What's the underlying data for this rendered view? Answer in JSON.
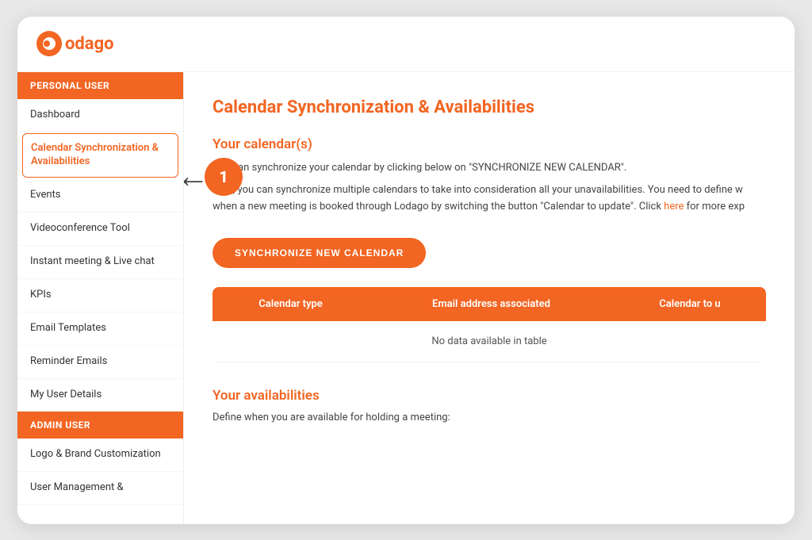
{
  "app": {
    "logo_text": "odago",
    "logo_icon": "O"
  },
  "sidebar": {
    "personal_user_label": "PERSONAL USER",
    "admin_user_label": "ADMIN USER",
    "items_personal": [
      {
        "id": "dashboard",
        "label": "Dashboard",
        "active": false
      },
      {
        "id": "calendar-sync",
        "label": "Calendar Synchronization & Availabilities",
        "active": true
      },
      {
        "id": "events",
        "label": "Events",
        "active": false
      },
      {
        "id": "videoconference",
        "label": "Videoconference Tool",
        "active": false
      },
      {
        "id": "instant-meeting",
        "label": "Instant meeting & Live chat",
        "active": false
      },
      {
        "id": "kpis",
        "label": "KPIs",
        "active": false
      },
      {
        "id": "email-templates",
        "label": "Email Templates",
        "active": false
      },
      {
        "id": "reminder-emails",
        "label": "Reminder Emails",
        "active": false
      },
      {
        "id": "my-user-details",
        "label": "My User Details",
        "active": false
      }
    ],
    "items_admin": [
      {
        "id": "logo-brand",
        "label": "Logo & Brand Customization",
        "active": false
      },
      {
        "id": "user-management",
        "label": "User Management &",
        "active": false
      }
    ]
  },
  "content": {
    "page_title": "Calendar Synchronization & Availabilities",
    "your_calendars_title": "Your calendar(s)",
    "description_1": "You can synchronize your calendar by clicking below on \"SYNCHRONIZE NEW CALENDAR\".",
    "description_2": "Also, you can synchronize multiple calendars to take into consideration all your unavailabilities. You need to define w when a new meeting is booked through Lodago by switching the button \"Calendar to update\". Click",
    "description_link": "here",
    "description_2_end": "for more exp",
    "sync_button_label": "SYNCHRONIZE NEW CALENDAR",
    "table": {
      "col1": "Calendar type",
      "col2": "Email address associated",
      "col3": "Calendar to u",
      "empty_message": "No data available in table"
    },
    "availabilities_title": "Your availabilities",
    "availabilities_desc": "Define when you are available for holding a meeting:"
  },
  "annotation": {
    "step_number": "1",
    "arrow_char": "←"
  }
}
